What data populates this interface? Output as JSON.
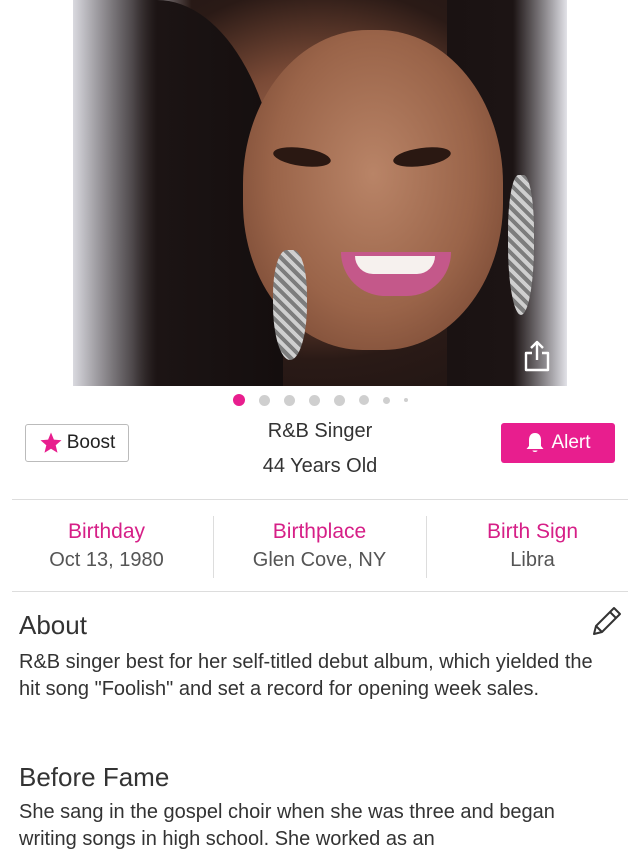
{
  "profile": {
    "photo_alt": "",
    "occupation": "R&B Singer",
    "age": "44 Years Old"
  },
  "carousel": {
    "total_dots": 8,
    "active_index": 0
  },
  "actions": {
    "boost_label": "Boost",
    "alert_label": "Alert"
  },
  "facts": [
    {
      "title": "Birthday",
      "value": "Oct 13, 1980"
    },
    {
      "title": "Birthplace",
      "value": "Glen Cove, NY"
    },
    {
      "title": "Birth Sign",
      "value": "Libra"
    }
  ],
  "about": {
    "title": "About",
    "text": "R&B singer best for her self-titled debut album, which yielded the hit song \"Foolish\" and set a record for opening week sales."
  },
  "before_fame": {
    "title": "Before Fame",
    "text": "She sang in the gospel choir when she was three and began writing songs in high school. She worked as an"
  },
  "colors": {
    "accent": "#e81e8e",
    "fact_title": "#d61f87",
    "divider": "#dddddd"
  },
  "icons": {
    "share": "share-icon",
    "star": "star-icon",
    "bell": "bell-icon",
    "edit": "pencil-icon"
  }
}
